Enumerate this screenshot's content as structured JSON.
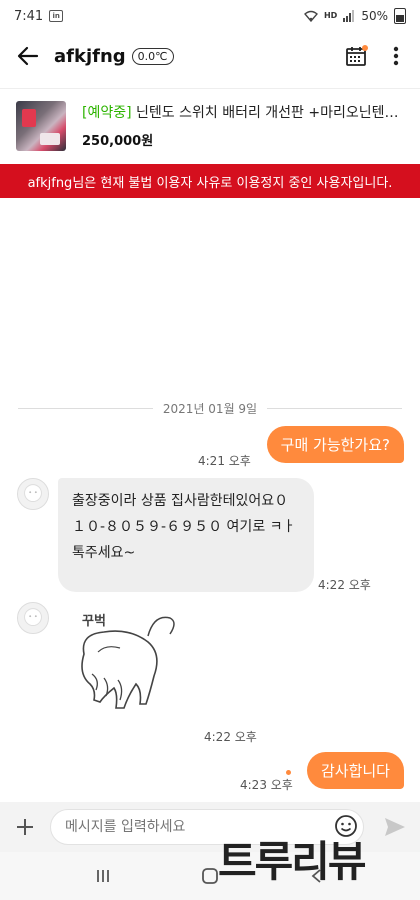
{
  "status_bar": {
    "time": "7:41",
    "app_badge": "in",
    "hd_label": "HD",
    "battery_percent": "50%"
  },
  "header": {
    "title": "afkjfng",
    "temperature": "0.0℃"
  },
  "product": {
    "status": "[예약중]",
    "title": " 닌텐도 스위치 배터리 개선판 +마리오닌텐도…",
    "price": "250,000원"
  },
  "banner": {
    "text": "afkjfng님은 현재 불법 이용자 사유로 이용정지 중인 사용자입니다."
  },
  "chat": {
    "date": "2021년 01월 9일",
    "messages": [
      {
        "side": "right",
        "text": "구매 가능한가요?",
        "time": "4:21 오후"
      },
      {
        "side": "left",
        "text": "출장중이라 상품 집사람한테있어요０１０-８０５９-６９５０ 여기로 ㅋㅏ톡주세요~",
        "time": "4:22 오후"
      },
      {
        "side": "left",
        "sticker_text": "꾸벅",
        "time": "4:22 오후"
      },
      {
        "side": "right",
        "text": "감사합니다",
        "time": "4:23 오후"
      }
    ]
  },
  "input": {
    "placeholder": "메시지를 입력하세요"
  },
  "watermark": "트루리뷰",
  "colors": {
    "accent": "#ff8a3d",
    "banner": "#d50f1e",
    "reserved": "#2db400"
  },
  "icons": [
    "back-arrow-icon",
    "calendar-icon",
    "more-vertical-icon",
    "plus-icon",
    "emoji-icon",
    "send-icon",
    "recent-apps-icon",
    "home-icon",
    "back-nav-icon"
  ]
}
